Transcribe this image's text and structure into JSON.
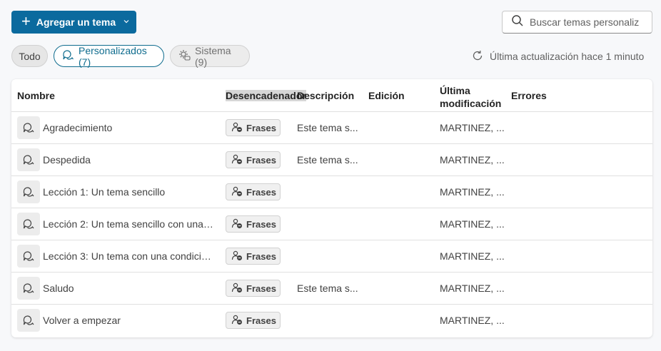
{
  "toolbar": {
    "add_label": "Agregar un tema",
    "search_placeholder": "Buscar temas personaliz"
  },
  "filters": {
    "todo": "Todo",
    "personalizados": "Personalizados (7)",
    "sistema": "Sistema (9)"
  },
  "refresh_text": "Última actualización hace 1 minuto",
  "table": {
    "headers": {
      "nombre": "Nombre",
      "desencadenador": "Desencadenador",
      "descripcion": "Descripción",
      "edicion": "Edición",
      "ultima_modificacion": "Última modificación",
      "errores": "Errores"
    },
    "rows": [
      {
        "name": "Agradecimiento",
        "trigger": "Frases",
        "description": "Este tema s...",
        "edition": "",
        "modified": "MARTINEZ, ...",
        "errors": ""
      },
      {
        "name": "Despedida",
        "trigger": "Frases",
        "description": "Este tema s...",
        "edition": "",
        "modified": "MARTINEZ, ...",
        "errors": ""
      },
      {
        "name": "Lección 1: Un tema sencillo",
        "trigger": "Frases",
        "description": "",
        "edition": "",
        "modified": "MARTINEZ, ...",
        "errors": ""
      },
      {
        "name": "Lección 2: Un tema sencillo con una ...",
        "trigger": "Frases",
        "description": "",
        "edition": "",
        "modified": "MARTINEZ, ...",
        "errors": ""
      },
      {
        "name": "Lección 3: Un tema con una condició...",
        "trigger": "Frases",
        "description": "",
        "edition": "",
        "modified": "MARTINEZ, ...",
        "errors": ""
      },
      {
        "name": "Saludo",
        "trigger": "Frases",
        "description": "Este tema s...",
        "edition": "",
        "modified": "MARTINEZ, ...",
        "errors": ""
      },
      {
        "name": "Volver a empezar",
        "trigger": "Frases",
        "description": "",
        "edition": "",
        "modified": "MARTINEZ, ...",
        "errors": ""
      }
    ]
  },
  "colors": {
    "accent": "#0b6a9e",
    "selected_pill": "#0f6c8e"
  }
}
